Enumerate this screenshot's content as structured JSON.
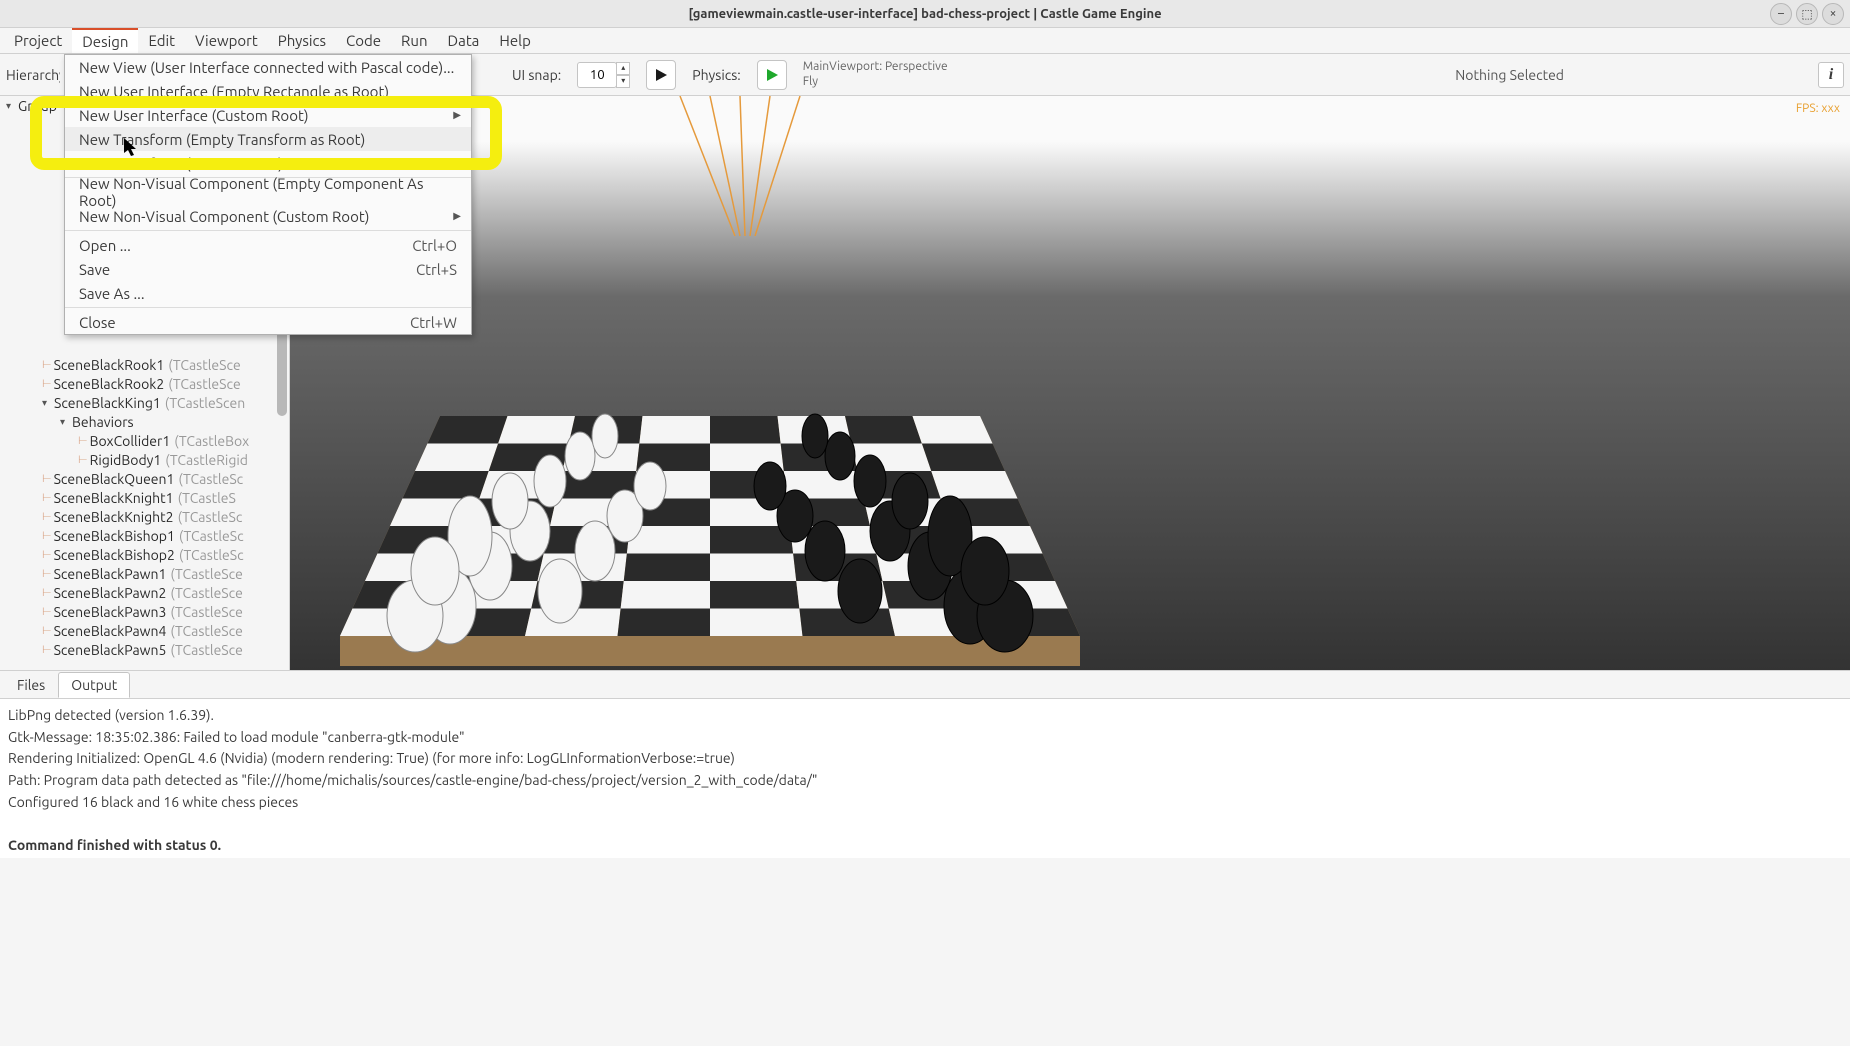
{
  "window": {
    "title": "[gameviewmain.castle-user-interface] bad-chess-project | Castle Game Engine"
  },
  "menubar": {
    "items": [
      "Project",
      "Design",
      "Edit",
      "Viewport",
      "Physics",
      "Code",
      "Run",
      "Data",
      "Help"
    ],
    "active_index": 1
  },
  "design_menu": {
    "items": [
      {
        "label": "New View (User Interface connected with Pascal code)...",
        "kind": "item"
      },
      {
        "label": "New User Interface (Empty Rectangle as Root)",
        "kind": "item"
      },
      {
        "label": "New User Interface (Custom Root)",
        "kind": "submenu"
      },
      {
        "label": "New Transform (Empty Transform as Root)",
        "kind": "item",
        "hover": true
      },
      {
        "label": "New Transform (Custom Root)",
        "kind": "submenu"
      },
      {
        "kind": "sep"
      },
      {
        "label": "New Non-Visual Component (Empty Component As Root)",
        "kind": "item"
      },
      {
        "label": "New Non-Visual Component (Custom Root)",
        "kind": "submenu"
      },
      {
        "kind": "sep"
      },
      {
        "label": "Open ...",
        "shortcut": "Ctrl+O",
        "kind": "item"
      },
      {
        "label": "Save",
        "shortcut": "Ctrl+S",
        "kind": "item"
      },
      {
        "label": "Save As ...",
        "kind": "item"
      },
      {
        "kind": "sep"
      },
      {
        "label": "Close",
        "shortcut": "Ctrl+W",
        "kind": "item"
      }
    ]
  },
  "toolbar": {
    "hierarchy_label": "Hierarchy",
    "ui_snap_label": "UI snap:",
    "ui_snap_value": "10",
    "physics_label": "Physics:",
    "viewport_info_line1": "MainViewport: Perspective",
    "viewport_info_line2": "Fly",
    "selection_status": "Nothing Selected"
  },
  "viewport": {
    "fps_label": "FPS: xxx"
  },
  "hierarchy": {
    "root": "Group",
    "visible_items": [
      {
        "depth": 2,
        "name": "SceneBlackRook1",
        "type": "(TCastleSce"
      },
      {
        "depth": 2,
        "name": "SceneBlackRook2",
        "type": "(TCastleSce"
      },
      {
        "depth": 2,
        "name": "SceneBlackKing1",
        "type": "(TCastleScen",
        "caret": "▾"
      },
      {
        "depth": 3,
        "name": "Behaviors",
        "caret": "▾"
      },
      {
        "depth": 4,
        "name": "BoxCollider1",
        "type": "(TCastleBox"
      },
      {
        "depth": 4,
        "name": "RigidBody1",
        "type": "(TCastleRigid"
      },
      {
        "depth": 2,
        "name": "SceneBlackQueen1",
        "type": "(TCastleSc"
      },
      {
        "depth": 2,
        "name": "SceneBlackKnight1",
        "type": "(TCastleS"
      },
      {
        "depth": 2,
        "name": "SceneBlackKnight2",
        "type": "(TCastleSc"
      },
      {
        "depth": 2,
        "name": "SceneBlackBishop1",
        "type": "(TCastleSc"
      },
      {
        "depth": 2,
        "name": "SceneBlackBishop2",
        "type": "(TCastleSc"
      },
      {
        "depth": 2,
        "name": "SceneBlackPawn1",
        "type": "(TCastleSce"
      },
      {
        "depth": 2,
        "name": "SceneBlackPawn2",
        "type": "(TCastleSce"
      },
      {
        "depth": 2,
        "name": "SceneBlackPawn3",
        "type": "(TCastleSce"
      },
      {
        "depth": 2,
        "name": "SceneBlackPawn4",
        "type": "(TCastleSce"
      },
      {
        "depth": 2,
        "name": "SceneBlackPawn5",
        "type": "(TCastleSce"
      }
    ]
  },
  "bottom_tabs": {
    "tabs": [
      "Files",
      "Output"
    ],
    "active_index": 1
  },
  "output": {
    "lines": [
      "LibPng detected (version 1.6.39).",
      "Gtk-Message: 18:35:02.386: Failed to load module \"canberra-gtk-module\"",
      "Rendering Initialized: OpenGL 4.6 (Nvidia) (modern rendering: True) (for more info: LogGLInformationVerbose:=true)",
      "Path: Program data path detected as \"file:///home/michalis/sources/castle-engine/bad-chess/project/version_2_with_code/data/\"",
      "Configured 16 black and 16 white chess pieces",
      "",
      "Command finished with status 0."
    ]
  }
}
